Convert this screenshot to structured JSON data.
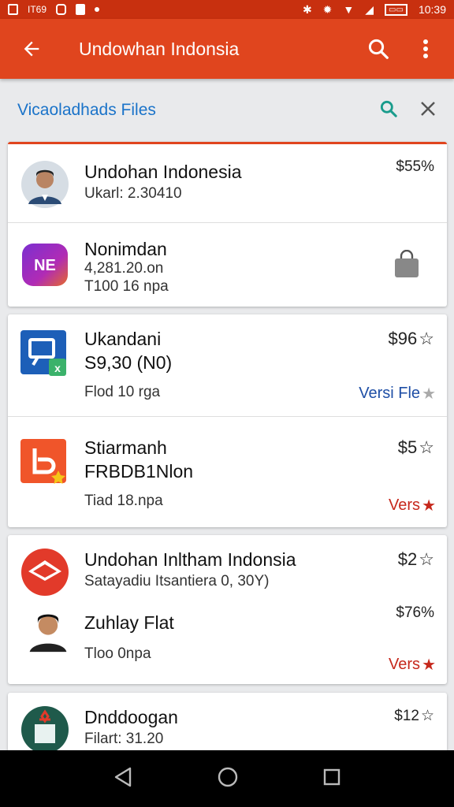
{
  "status_bar": {
    "time": "10:39",
    "notification": "IT69"
  },
  "app_bar": {
    "title": "Undowhan Indonsia"
  },
  "search": {
    "query": "Vicaoladhads Files"
  },
  "colors": {
    "primary": "#e0451e",
    "status": "#c8300f",
    "link_blue": "#1f4fa6",
    "accent_red": "#c6281c",
    "search_teal": "#1a9c8c"
  },
  "cards": [
    {
      "items": [
        {
          "name": "Undohan Indonesia",
          "line1": "Ukarl: 2.30410",
          "price": "$55%",
          "icon": "person-avatar-icon"
        },
        {
          "name": "Nonimdan",
          "line1": "4,281.20.on",
          "line2": "T100 16 npa",
          "icon": "ne-app-icon",
          "action_icon": "shopping-bag-icon"
        }
      ]
    },
    {
      "items": [
        {
          "name": "Ukandani",
          "line1": "S9,30 (N0)",
          "line2": "Flod 10 rga",
          "price": "$96",
          "tag": "Versi Fle",
          "icon": "blue-app-icon"
        },
        {
          "name": "Stiarmanh",
          "line1": "FRBDB1Nlon",
          "line2": "Tiad 18.npa",
          "price": "$5",
          "tag": "Vers",
          "icon": "orange-app-icon"
        }
      ]
    },
    {
      "items": [
        {
          "name": "Undohan Inltham Indonsia",
          "line1": "Satayadiu Itsantiera 0, 30Y)",
          "price": "$2",
          "icon": "red-diamond-icon"
        },
        {
          "name": "Zuhlay Flat",
          "line2": "Tloo 0npa",
          "price": "$76%",
          "tag": "Vers",
          "icon": "person-avatar-icon"
        }
      ]
    },
    {
      "items": [
        {
          "name": "Dnddoogan",
          "line1": "Filart: 31.20",
          "price": "$12",
          "icon": "green-app-icon"
        }
      ]
    }
  ]
}
